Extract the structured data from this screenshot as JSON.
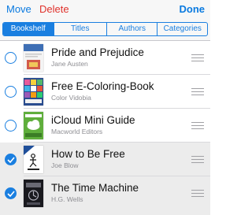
{
  "toolbar": {
    "move_label": "Move",
    "delete_label": "Delete",
    "done_label": "Done"
  },
  "tabs": [
    {
      "label": "Bookshelf",
      "active": true
    },
    {
      "label": "Titles",
      "active": false
    },
    {
      "label": "Authors",
      "active": false
    },
    {
      "label": "Categories",
      "active": false
    }
  ],
  "books": [
    {
      "title": "Pride and Prejudice",
      "author": "Jane Austen",
      "selected": false,
      "icon": "pride-and-prejudice-cover-icon"
    },
    {
      "title": "Free E-Coloring-Book",
      "author": "Color Vidobia",
      "selected": false,
      "icon": "coloring-book-cover-icon"
    },
    {
      "title": "iCloud Mini Guide",
      "author": "Macworld Editors",
      "selected": false,
      "icon": "icloud-guide-cover-icon"
    },
    {
      "title": "How to Be Free",
      "author": "Joe Blow",
      "selected": true,
      "icon": "how-to-be-free-cover-icon"
    },
    {
      "title": "The Time Machine",
      "author": "H.G. Wells",
      "selected": true,
      "icon": "time-machine-cover-icon"
    }
  ],
  "colors": {
    "accent": "#1a7fe0",
    "delete": "#e0312b",
    "selected_row": "#ececec"
  }
}
